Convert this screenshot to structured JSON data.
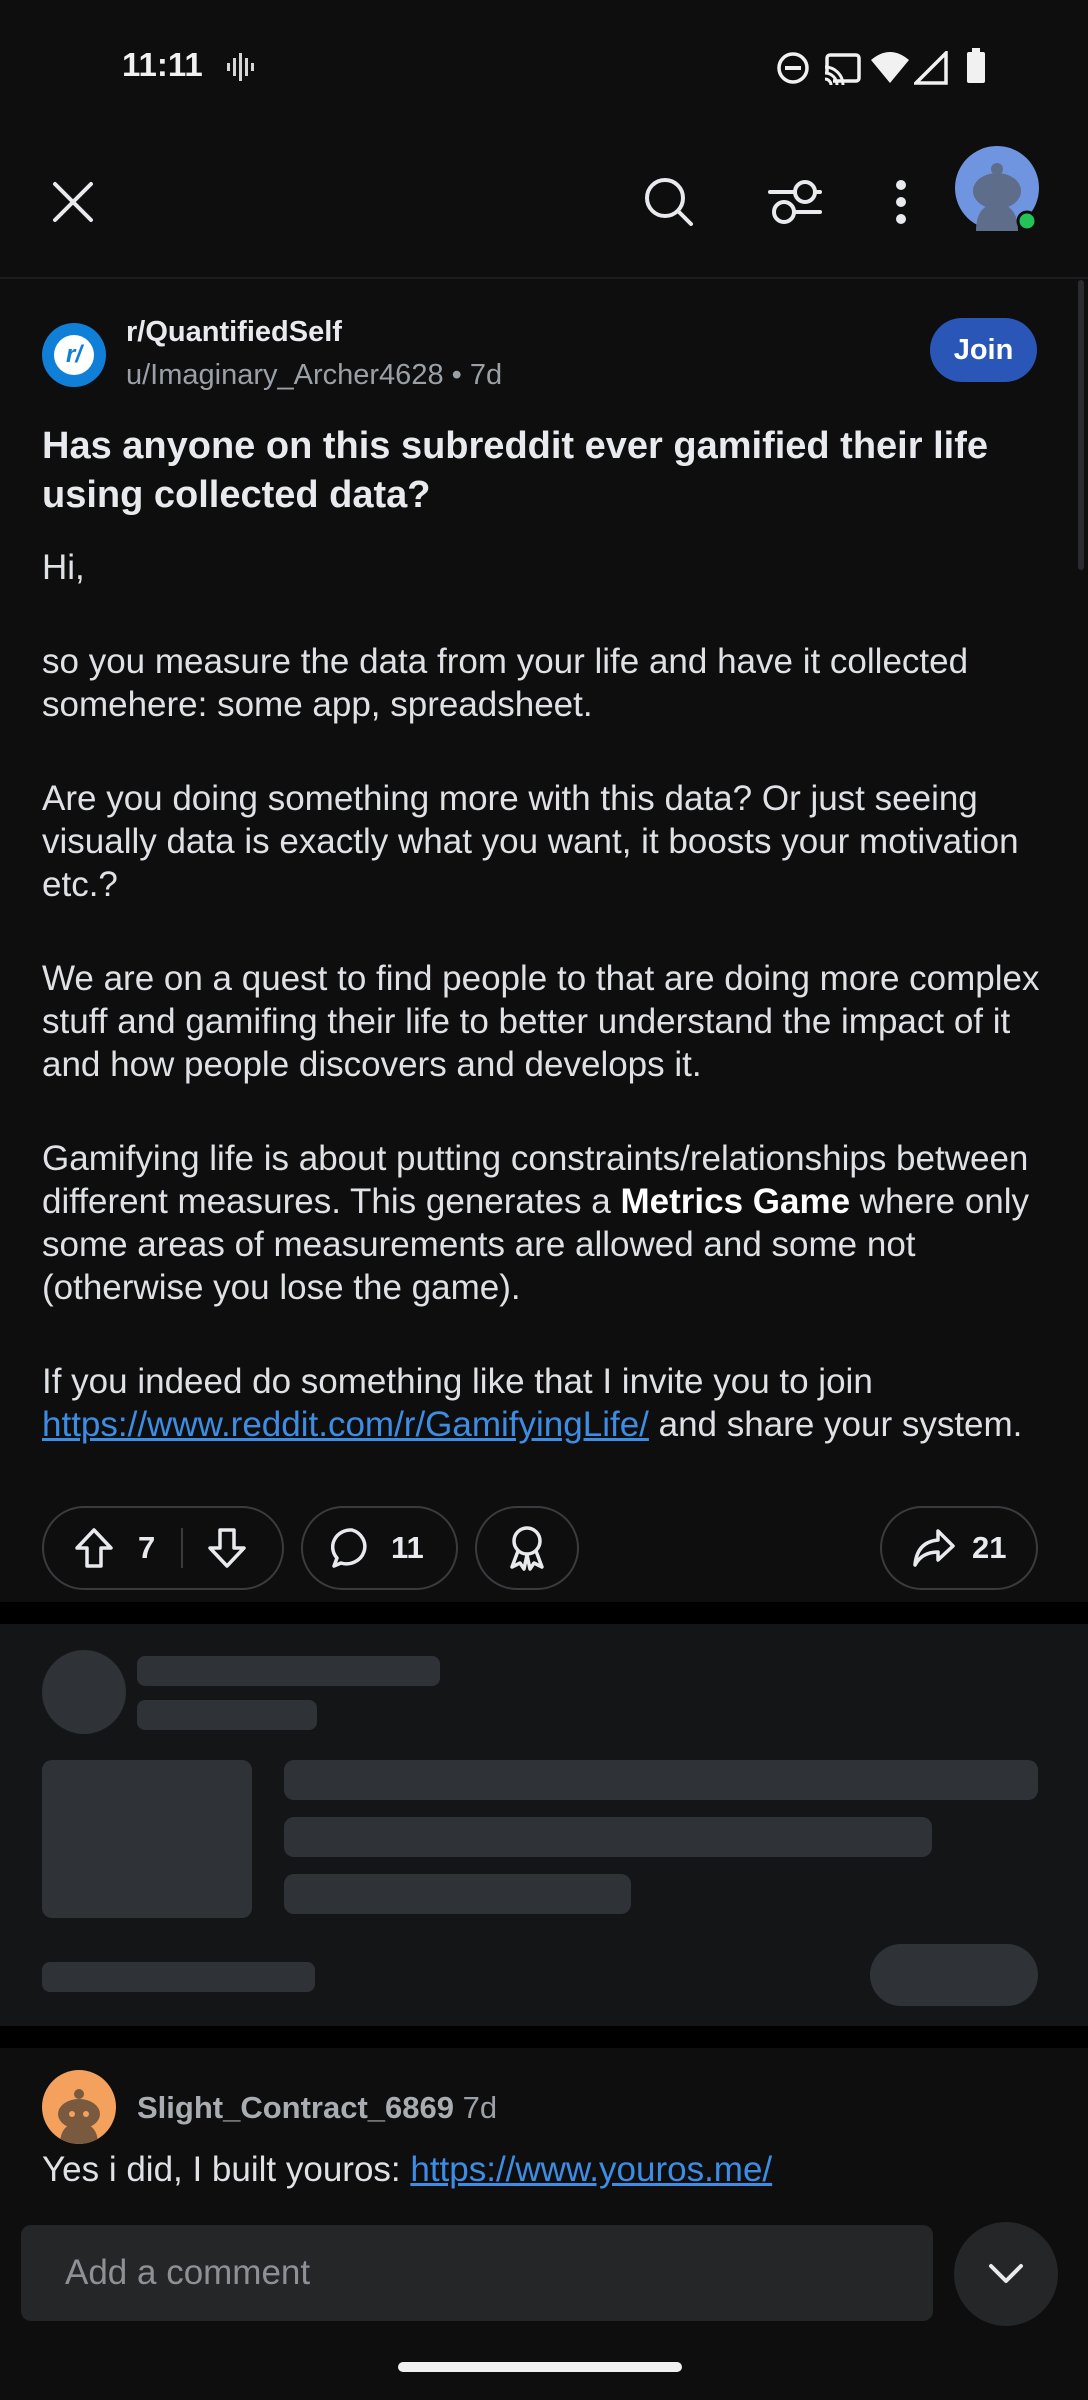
{
  "status_bar": {
    "time": "11:11"
  },
  "top_bar": {
    "close_icon": "close-icon",
    "search_icon": "search-icon",
    "filter_icon": "filter-icon",
    "more_icon": "more-vertical-icon",
    "avatar_online_color": "#23c35a"
  },
  "post": {
    "subreddit": "r/QuantifiedSelf",
    "subreddit_logo_text": "r/",
    "author": "u/Imaginary_Archer4628",
    "age": "7d",
    "join_label": "Join",
    "title": "Has anyone on this subreddit ever gamified their life using collected data?",
    "body": {
      "p1": "Hi,",
      "p2": "so you measure the data from your life and have it collected somehere: some app, spreadsheet.",
      "p3": "Are you doing something more with this data? Or just seeing visually data is exactly what you want, it boosts your motivation etc.?",
      "p4": "We are on a quest to find people to that are doing more complex stuff and gamifing their life to better understand the impact of it and how people discovers and develops it.",
      "p5_before": "Gamifying life is about putting constraints/relationships between different measures. This generates a ",
      "p5_bold": "Metrics Game",
      "p5_after": " where only some areas of measurements are allowed and some not (otherwise you lose the game).",
      "p6_before": "If you indeed do something like that I invite you to join ",
      "p6_link": "https://www.reddit.com/r/GamifyingLife/",
      "p6_after": " and share your system."
    },
    "votes": "7",
    "comments": "11",
    "shares": "21"
  },
  "comment": {
    "user": "Slight_Contract_6869",
    "age": "7d",
    "text_before": "Yes i did, I built youros: ",
    "link": "https://www.youros.me/"
  },
  "composer": {
    "placeholder": "Add a comment"
  },
  "colors": {
    "accent": "#2a56b8",
    "link": "#3d8de5",
    "background": "#0e0e0f"
  }
}
